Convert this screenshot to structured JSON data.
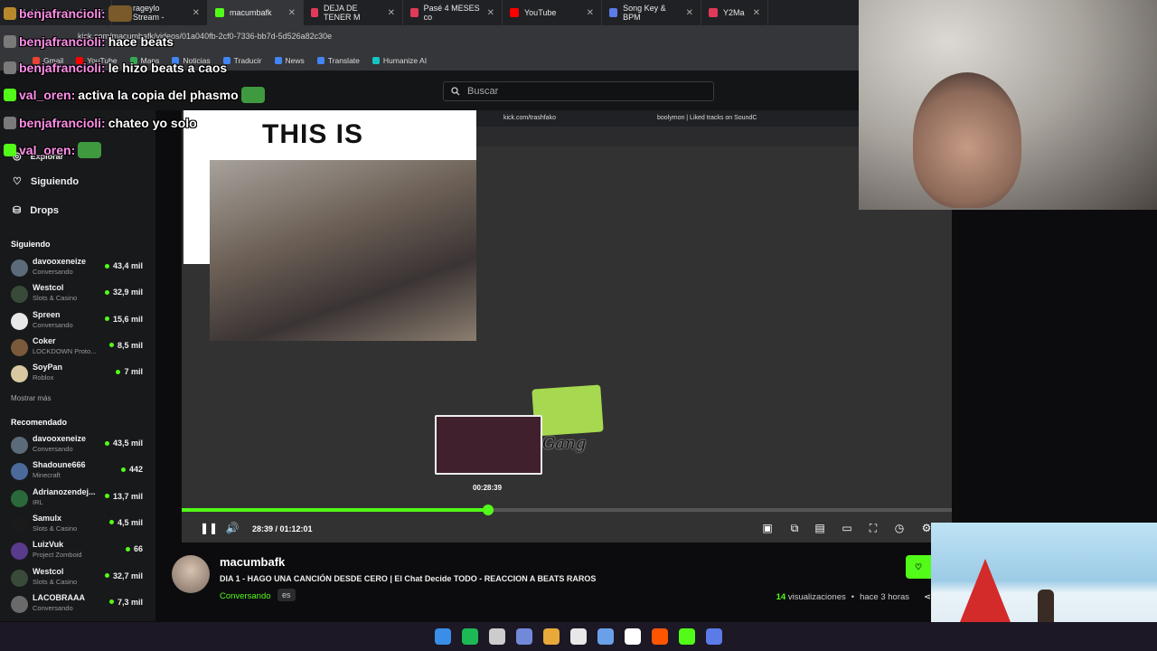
{
  "browser": {
    "tabs": [
      {
        "label": "Achievements - K",
        "color": "#b8892a"
      },
      {
        "label": "rageylo Stream -",
        "color": "#53fc18"
      },
      {
        "label": "macumbafk",
        "color": "#53fc18"
      },
      {
        "label": "DEJA DE TENER M",
        "color": "#e03a5a"
      },
      {
        "label": "Pasé 4 MESES co",
        "color": "#e03a5a"
      },
      {
        "label": "YouTube",
        "color": "#ff0000"
      },
      {
        "label": "Song Key & BPM",
        "color": "#5b7be8"
      },
      {
        "label": "Y2Ma",
        "color": "#e03a5a"
      }
    ],
    "address": "kick.com/macumbafk/videos/01a040fb-2cf0-7336-bb7d-5d526a82c30e",
    "bookmarks": [
      "Gmail",
      "YouTube",
      "Maps",
      "Noticias",
      "Traducir",
      "News",
      "Translate",
      "Humanize AI"
    ]
  },
  "header": {
    "search_placeholder": "Buscar"
  },
  "sidebar": {
    "nav": [
      "Explorar",
      "Siguiendo",
      "Drops"
    ],
    "following_title": "Siguiendo",
    "following": [
      {
        "name": "davooxeneize",
        "category": "Conversando",
        "viewers": "43,4 mil",
        "color": "#5c6b7a"
      },
      {
        "name": "Westcol",
        "category": "Slots & Casino",
        "viewers": "32,9 mil",
        "color": "#3a4a3a"
      },
      {
        "name": "Spreen",
        "category": "Conversando",
        "viewers": "15,6 mil",
        "color": "#e8e8e8"
      },
      {
        "name": "Coker",
        "category": "LOCKDOWN Proto...",
        "viewers": "8,5 mil",
        "color": "#7a5a3a"
      },
      {
        "name": "SoyPan",
        "category": "Roblox",
        "viewers": "7 mil",
        "color": "#d9c9a0"
      }
    ],
    "show_more": "Mostrar más",
    "recommended_title": "Recomendado",
    "recommended": [
      {
        "name": "davooxeneize",
        "category": "Conversando",
        "viewers": "43,5 mil",
        "color": "#5c6b7a"
      },
      {
        "name": "Shadoune666",
        "category": "Minecraft",
        "viewers": "442",
        "color": "#4a6a9a"
      },
      {
        "name": "Adrianozendej...",
        "category": "IRL",
        "viewers": "13,7 mil",
        "color": "#2a6a3a"
      },
      {
        "name": "Samulx",
        "category": "Slots & Casino",
        "viewers": "4,5 mil",
        "color": "#1a1a1a"
      },
      {
        "name": "LuizVuk",
        "category": "Project Zomboid",
        "viewers": "66",
        "color": "#5a3a8a"
      },
      {
        "name": "Westcol",
        "category": "Slots & Casino",
        "viewers": "32,7 mil",
        "color": "#3a4a3a"
      },
      {
        "name": "LACOBRAAA",
        "category": "Conversando",
        "viewers": "7,3 mil",
        "color": "#6a6a6a"
      }
    ]
  },
  "player": {
    "overlay_title": "THIS IS",
    "inner_tabs": [
      "kick.com/trashfako",
      "boolymon | Liked tracks on SoundC"
    ],
    "hover_time": "00:28:39",
    "timecode": "28:39 / 01:12:01",
    "progress": 0.3975,
    "sticker_text": "Gang"
  },
  "video_info": {
    "streamer": "macumbafk",
    "title": "DIA 1 - HAGO UNA CANCIÓN DESDE CERO | El Chat Decide TODO - REACCION A BEATS RAROS",
    "category": "Conversando",
    "language": "es",
    "views_count": "14",
    "views_label": "visualizaciones",
    "age": "hace 3 horas"
  },
  "chat_overlay": [
    {
      "user": "benjafrancioli:",
      "text": "",
      "badge": "#b8892a"
    },
    {
      "user": "benjafrancioli:",
      "text": "hace beats",
      "badge": "#7a7a7a"
    },
    {
      "user": "benjafrancioli:",
      "text": "le hizo beats a caos",
      "badge": "#7a7a7a"
    },
    {
      "user": "val_oren:",
      "text": "activa la copia del phasmo",
      "badge": "#53fc18"
    },
    {
      "user": "benjafrancioli:",
      "text": "chateo yo solo",
      "badge": "#7a7a7a"
    },
    {
      "user": "val_oren:",
      "text": "",
      "badge": "#53fc18"
    }
  ],
  "taskbar": [
    "#3a8ee8",
    "#1db954",
    "#cccccc",
    "#7289da",
    "#e8a93a",
    "#e8e8e8",
    "#6aa0e8",
    "#ffffff",
    "#ff5500",
    "#53fc18",
    "#5b7be8"
  ]
}
